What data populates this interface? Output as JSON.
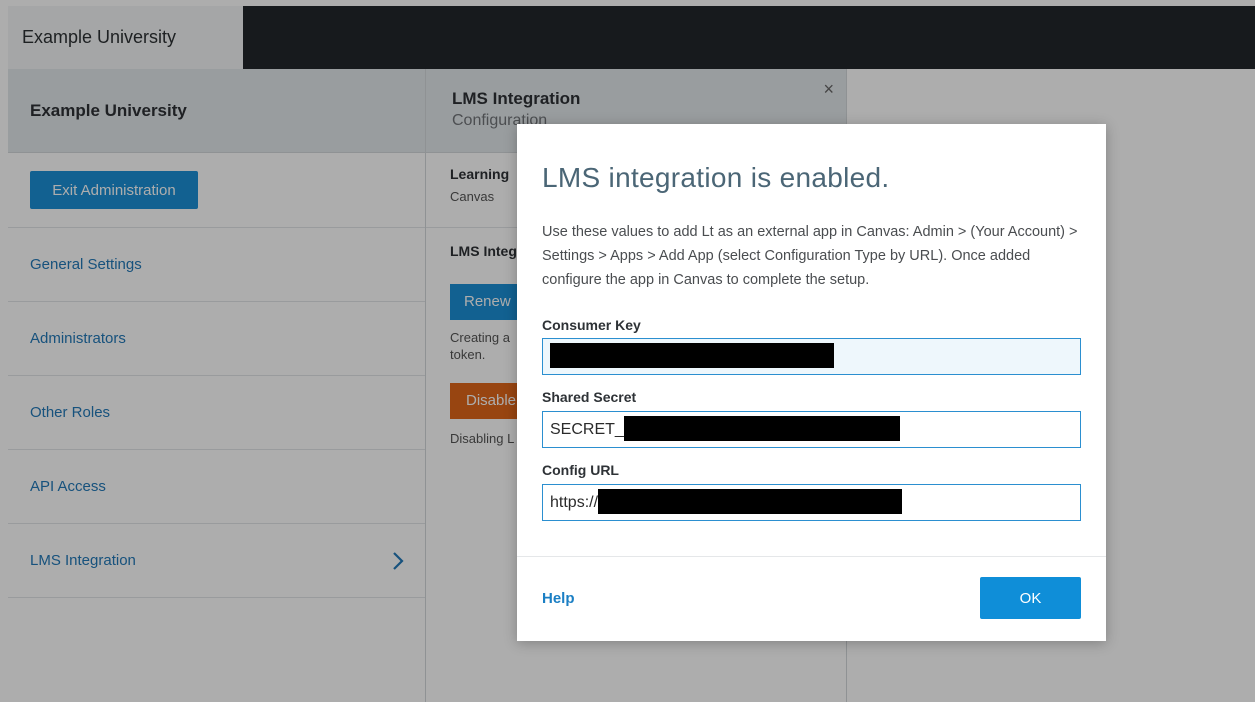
{
  "topbar": {
    "tab_label": "Example University"
  },
  "sidebar": {
    "header": "Example University",
    "exit_label": "Exit Administration",
    "items": [
      {
        "label": "General Settings"
      },
      {
        "label": "Administrators"
      },
      {
        "label": "Other Roles"
      },
      {
        "label": "API Access"
      },
      {
        "label": "LMS Integration"
      }
    ]
  },
  "panel": {
    "title": "LMS Integration",
    "subtitle": "Configuration",
    "close_glyph": "×",
    "learning_label": "Learning",
    "learning_value": "Canvas",
    "lms_label": "LMS Integ",
    "renew_label": "Renew",
    "creating_text": "Creating a token.",
    "disable_label": "Disable",
    "disabling_text": "Disabling L"
  },
  "modal": {
    "title": "LMS integration is enabled.",
    "description": "Use these values to add Lt as an external app in Canvas: Admin > (Your Account) > Settings > Apps > Add App (select Configuration Type by URL). Once added configure the app in Canvas to complete the setup.",
    "consumer_key_label": "Consumer Key",
    "consumer_key_value": "",
    "shared_secret_label": "Shared Secret",
    "shared_secret_prefix": "SECRET_",
    "config_url_label": "Config URL",
    "config_url_prefix": "https://",
    "help_label": "Help",
    "ok_label": "OK"
  },
  "colors": {
    "accent": "#0f8ed8",
    "danger": "#e0661a",
    "topbar": "#22272c"
  },
  "icons": [
    "chevron-right-icon",
    "close-icon"
  ]
}
